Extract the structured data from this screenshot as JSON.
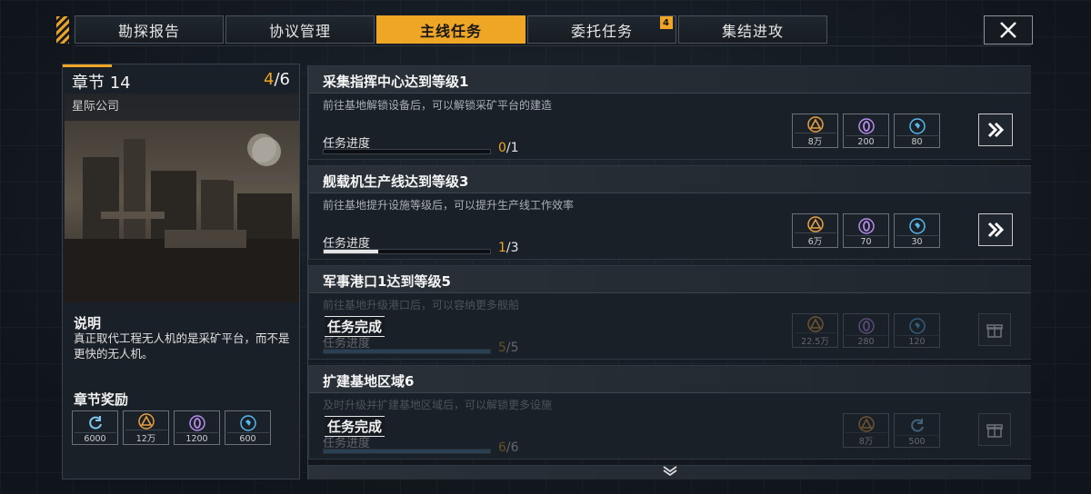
{
  "tabs": [
    {
      "label": "勘探报告",
      "active": false,
      "badge": null
    },
    {
      "label": "协议管理",
      "active": false,
      "badge": null
    },
    {
      "label": "主线任务",
      "active": true,
      "badge": null
    },
    {
      "label": "委托任务",
      "active": false,
      "badge": "4"
    },
    {
      "label": "集结进攻",
      "active": false,
      "badge": null
    }
  ],
  "chapter": {
    "title": "章节 14",
    "progress_current": "4",
    "progress_total": "/6",
    "company": "星际公司",
    "desc_title": "说明",
    "desc_text": "真正取代工程无人机的是采矿平台，而不是更快的无人机。",
    "reward_title": "章节奖励",
    "rewards": [
      {
        "icon": "refresh-icon",
        "amount": "6000"
      },
      {
        "icon": "triangle-icon",
        "amount": "12万"
      },
      {
        "icon": "zero-icon",
        "amount": "1200"
      },
      {
        "icon": "crystal-icon",
        "amount": "600"
      }
    ]
  },
  "progress_label": "任务进度",
  "done_label": "任务完成",
  "quests": [
    {
      "title": "采集指挥中心达到等级1",
      "desc": "前往基地解锁设备后，可以解锁采矿平台的建造",
      "current": "0",
      "total": "/1",
      "progress": 0.0,
      "done": false,
      "rewards": [
        {
          "icon": "triangle-icon",
          "amount": "8万"
        },
        {
          "icon": "zero-icon",
          "amount": "200"
        },
        {
          "icon": "crystal-icon",
          "amount": "80"
        }
      ]
    },
    {
      "title": "舰载机生产线达到等级3",
      "desc": "前往基地提升设施等级后，可以提升生产线工作效率",
      "current": "1",
      "total": "/3",
      "progress": 0.33,
      "done": false,
      "rewards": [
        {
          "icon": "triangle-icon",
          "amount": "6万"
        },
        {
          "icon": "zero-icon",
          "amount": "70"
        },
        {
          "icon": "crystal-icon",
          "amount": "30"
        }
      ]
    },
    {
      "title": "军事港口1达到等级5",
      "desc": "前往基地升级港口后，可以容纳更多舰船",
      "current": "5",
      "total": "/5",
      "progress": 1.0,
      "done": true,
      "rewards": [
        {
          "icon": "triangle-icon",
          "amount": "22.5万"
        },
        {
          "icon": "zero-icon",
          "amount": "280"
        },
        {
          "icon": "crystal-icon",
          "amount": "120"
        }
      ]
    },
    {
      "title": "扩建基地区域6",
      "desc": "及时升级并扩建基地区域后，可以解锁更多设施",
      "current": "6",
      "total": "/6",
      "progress": 1.0,
      "done": true,
      "rewards": [
        {
          "icon": "triangle-icon",
          "amount": "8万"
        },
        {
          "icon": "refresh-icon",
          "amount": "500"
        }
      ]
    }
  ],
  "colors": {
    "accent": "#f0a625",
    "panel": "#1a2028",
    "triangle": "#e8a040",
    "zero": "#b98cf0",
    "crystal": "#57b8f0",
    "refresh": "#7fc6f0"
  }
}
